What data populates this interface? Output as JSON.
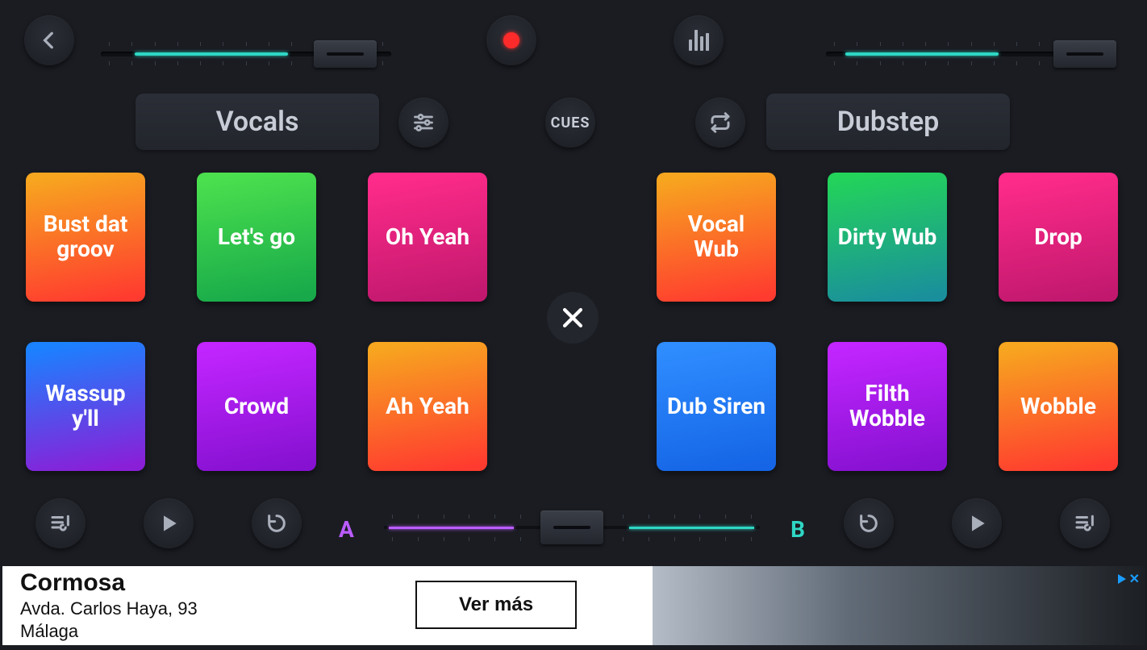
{
  "deckA": {
    "category_label": "Vocals",
    "pads": [
      {
        "label": "Bust dat groov",
        "grad": "g-or-rd"
      },
      {
        "label": "Let's go",
        "grad": "g-gr"
      },
      {
        "label": "Oh Yeah",
        "grad": "g-pk"
      },
      {
        "label": "Wassup y'll",
        "grad": "g-bl-pu"
      },
      {
        "label": "Crowd",
        "grad": "g-pu"
      },
      {
        "label": "Ah Yeah",
        "grad": "g-or-rd"
      }
    ]
  },
  "deckB": {
    "category_label": "Dubstep",
    "pads": [
      {
        "label": "Vocal Wub",
        "grad": "g-or-rd"
      },
      {
        "label": "Dirty Wub",
        "grad": "g-gr-bl"
      },
      {
        "label": "Drop",
        "grad": "g-pk"
      },
      {
        "label": "Dub Siren",
        "grad": "g-bl"
      },
      {
        "label": "Filth Wobble",
        "grad": "g-pu"
      },
      {
        "label": "Wobble",
        "grad": "g-or-rd"
      }
    ]
  },
  "cues_label": "CUES",
  "crossfader": {
    "a_label": "A",
    "b_label": "B",
    "position": 0.5
  },
  "top_sliders": {
    "left": {
      "fill_color": "teal",
      "value": 0.6
    },
    "right": {
      "fill_color": "teal",
      "value": 0.6
    }
  },
  "ad": {
    "title": "Cormosa",
    "address_line1": "Avda. Carlos Haya, 93",
    "address_line2": "Málaga",
    "cta": "Ver más"
  }
}
